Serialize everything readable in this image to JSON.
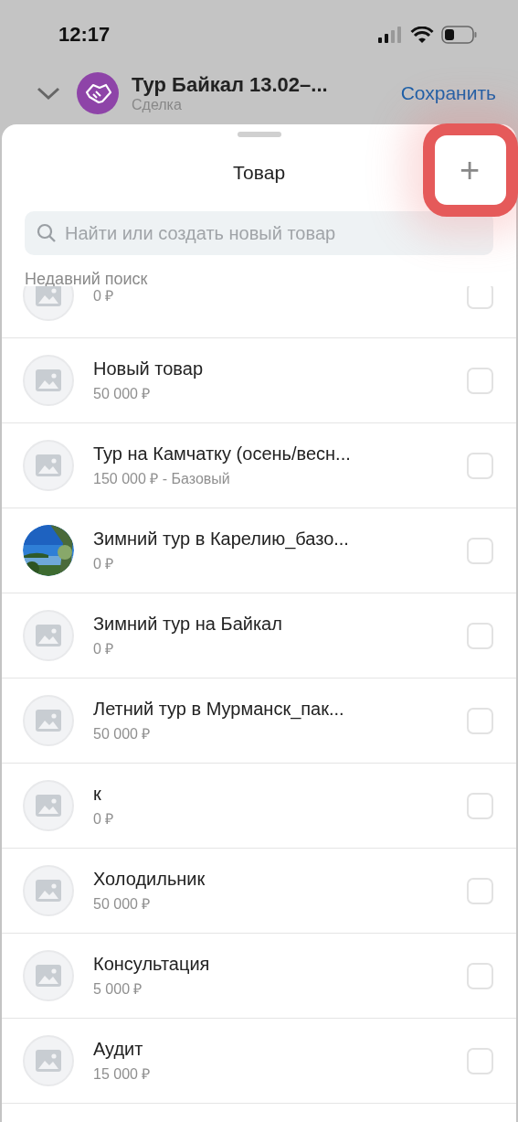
{
  "status_bar": {
    "time": "12:17"
  },
  "header": {
    "title": "Тур Байкал 13.02–...",
    "subtitle": "Сделка",
    "save": "Сохранить"
  },
  "sheet": {
    "title": "Товар",
    "add_button": {
      "label": "+",
      "highlighted": true
    },
    "search": {
      "placeholder": "Найти или создать новый товар"
    },
    "section": "Недавний поиск",
    "items": [
      {
        "price": "0 ₽",
        "kind": "placeholder",
        "checked": false
      },
      {
        "name": "Новый товар",
        "price": "50 000 ₽",
        "kind": "placeholder",
        "checked": false
      },
      {
        "name": "Тур на Камчатку (осень/весн...",
        "price": "150 000 ₽ - Базовый",
        "kind": "placeholder",
        "checked": false
      },
      {
        "name": "Зимний тур в Карелию_базо...",
        "price": "0 ₽",
        "kind": "picture",
        "checked": false
      },
      {
        "name": "Зимний тур на Байкал",
        "price": "0 ₽",
        "kind": "placeholder",
        "checked": false
      },
      {
        "name": "Летний тур в Мурманск_пак...",
        "price": "50 000 ₽",
        "kind": "placeholder",
        "checked": false
      },
      {
        "name": "к",
        "price": "0 ₽",
        "kind": "placeholder",
        "checked": false
      },
      {
        "name": "Холодильник",
        "price": "50 000 ₽",
        "kind": "placeholder",
        "checked": false
      },
      {
        "name": "Консультация",
        "price": "5 000 ₽",
        "kind": "placeholder",
        "checked": false
      },
      {
        "name": "Аудит",
        "price": "15 000 ₽",
        "kind": "placeholder",
        "checked": false
      }
    ]
  }
}
